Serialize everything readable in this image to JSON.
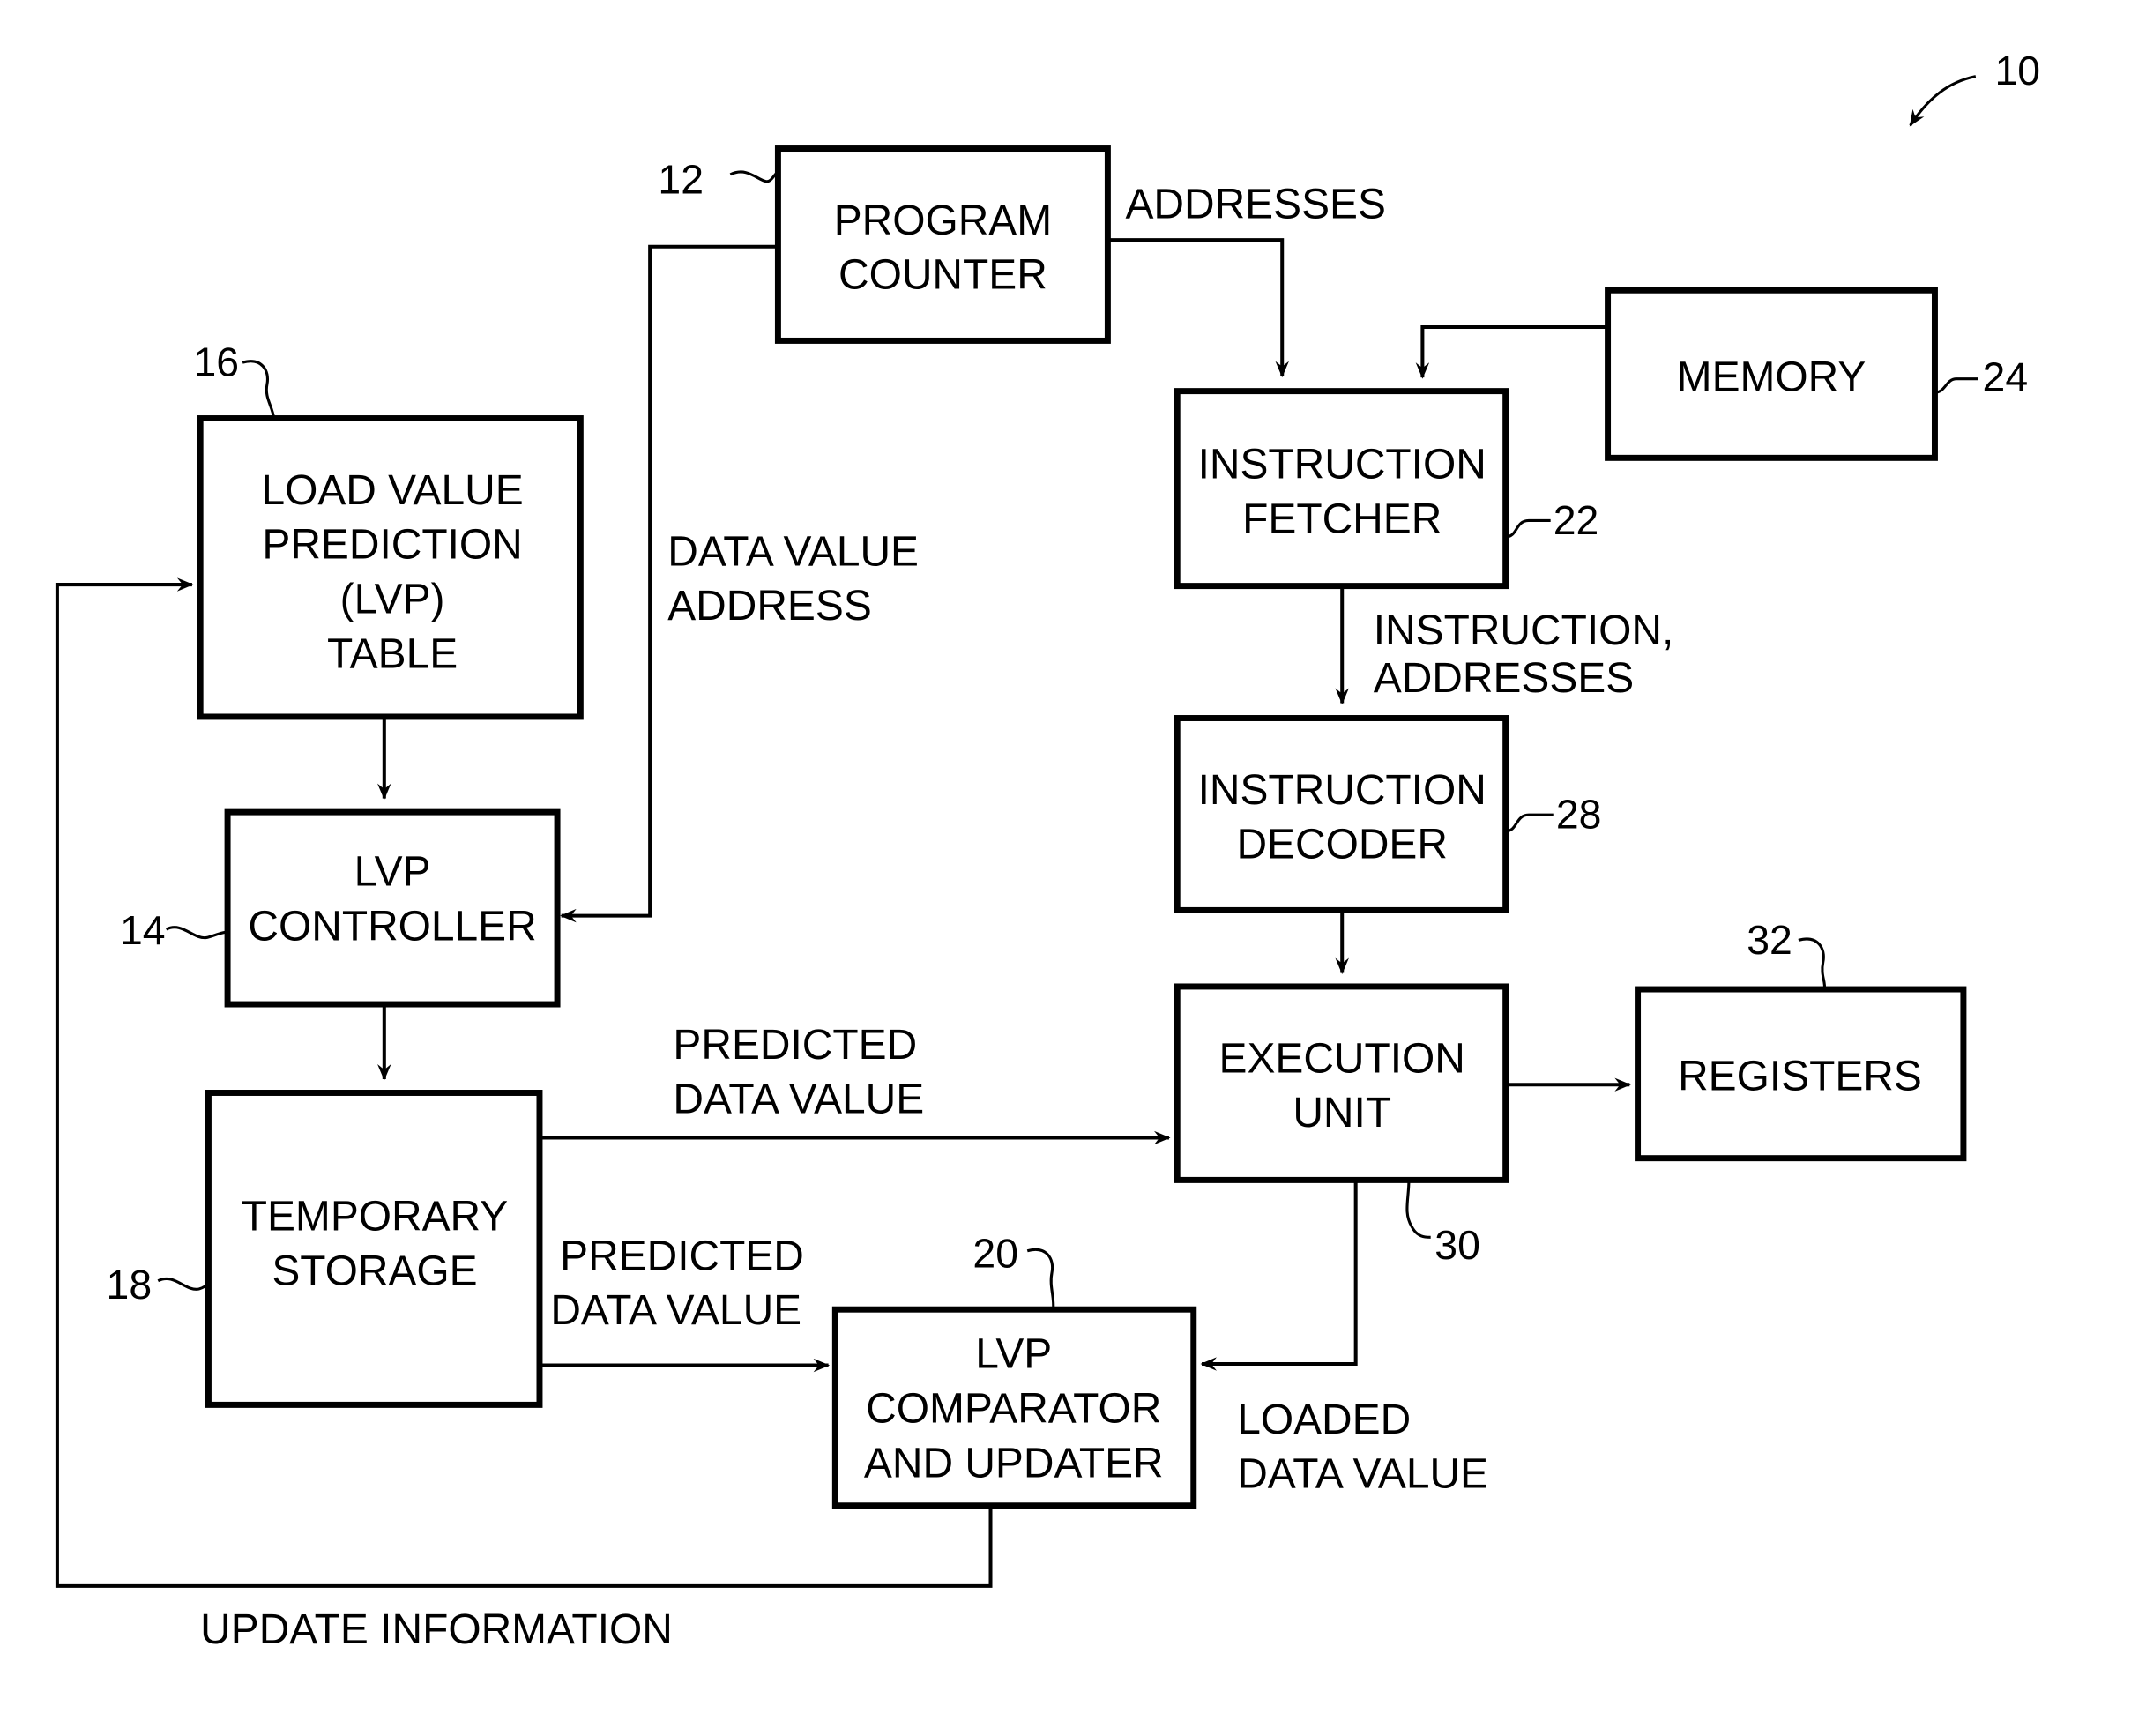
{
  "figure": {
    "ref": "10",
    "blocks": {
      "program_counter": {
        "ref": "12",
        "lines": [
          "PROGRAM",
          "COUNTER"
        ]
      },
      "lvp_controller": {
        "ref": "14",
        "lines": [
          "LVP",
          "CONTROLLER"
        ]
      },
      "lvp_table": {
        "ref": "16",
        "lines": [
          "LOAD VALUE",
          "PREDICTION",
          "(LVP)",
          "TABLE"
        ]
      },
      "temporary_storage": {
        "ref": "18",
        "lines": [
          "TEMPORARY",
          "STORAGE"
        ]
      },
      "lvp_comparator": {
        "ref": "20",
        "lines": [
          "LVP",
          "COMPARATOR",
          "AND UPDATER"
        ]
      },
      "instruction_fetcher": {
        "ref": "22",
        "lines": [
          "INSTRUCTION",
          "FETCHER"
        ]
      },
      "memory": {
        "ref": "24",
        "lines": [
          "MEMORY"
        ]
      },
      "instruction_decoder": {
        "ref": "28",
        "lines": [
          "INSTRUCTION",
          "DECODER"
        ]
      },
      "execution_unit": {
        "ref": "30",
        "lines": [
          "EXECUTION",
          "UNIT"
        ]
      },
      "registers": {
        "ref": "32",
        "lines": [
          "REGISTERS"
        ]
      }
    },
    "signals": {
      "addresses": [
        "ADDRESSES"
      ],
      "data_value_address": [
        "DATA VALUE",
        "ADDRESS"
      ],
      "instruction_addresses": [
        "INSTRUCTION,",
        "ADDRESSES"
      ],
      "predicted_to_exec": [
        "PREDICTED",
        "DATA VALUE"
      ],
      "predicted_to_comparator": [
        "PREDICTED",
        "DATA VALUE"
      ],
      "loaded_data_value": [
        "LOADED",
        "DATA VALUE"
      ],
      "update_information": [
        "UPDATE INFORMATION"
      ]
    }
  }
}
